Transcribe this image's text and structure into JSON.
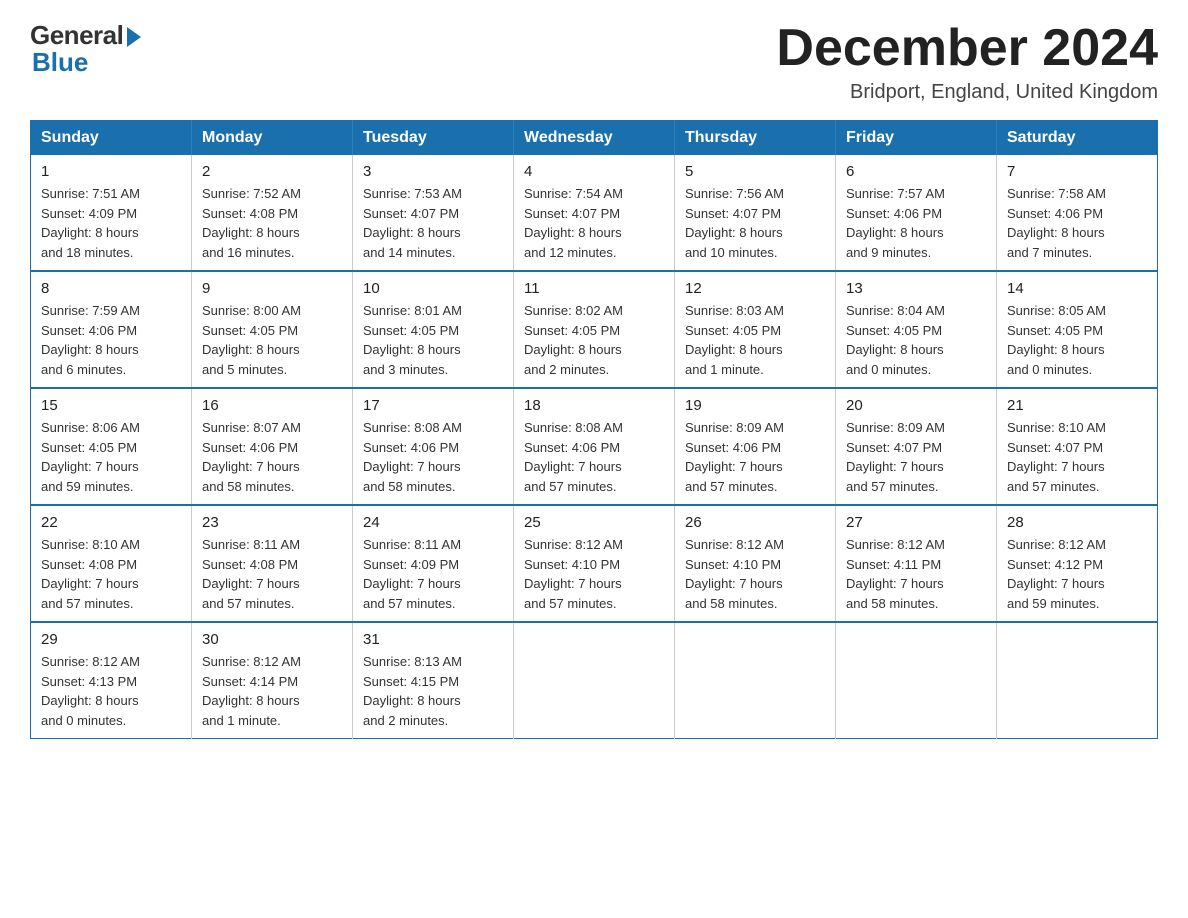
{
  "logo": {
    "general": "General",
    "blue": "Blue"
  },
  "title": {
    "month": "December 2024",
    "location": "Bridport, England, United Kingdom"
  },
  "weekdays": [
    "Sunday",
    "Monday",
    "Tuesday",
    "Wednesday",
    "Thursday",
    "Friday",
    "Saturday"
  ],
  "weeks": [
    [
      {
        "day": "1",
        "sunrise": "7:51 AM",
        "sunset": "4:09 PM",
        "daylight": "8 hours and 18 minutes."
      },
      {
        "day": "2",
        "sunrise": "7:52 AM",
        "sunset": "4:08 PM",
        "daylight": "8 hours and 16 minutes."
      },
      {
        "day": "3",
        "sunrise": "7:53 AM",
        "sunset": "4:07 PM",
        "daylight": "8 hours and 14 minutes."
      },
      {
        "day": "4",
        "sunrise": "7:54 AM",
        "sunset": "4:07 PM",
        "daylight": "8 hours and 12 minutes."
      },
      {
        "day": "5",
        "sunrise": "7:56 AM",
        "sunset": "4:07 PM",
        "daylight": "8 hours and 10 minutes."
      },
      {
        "day": "6",
        "sunrise": "7:57 AM",
        "sunset": "4:06 PM",
        "daylight": "8 hours and 9 minutes."
      },
      {
        "day": "7",
        "sunrise": "7:58 AM",
        "sunset": "4:06 PM",
        "daylight": "8 hours and 7 minutes."
      }
    ],
    [
      {
        "day": "8",
        "sunrise": "7:59 AM",
        "sunset": "4:06 PM",
        "daylight": "8 hours and 6 minutes."
      },
      {
        "day": "9",
        "sunrise": "8:00 AM",
        "sunset": "4:05 PM",
        "daylight": "8 hours and 5 minutes."
      },
      {
        "day": "10",
        "sunrise": "8:01 AM",
        "sunset": "4:05 PM",
        "daylight": "8 hours and 3 minutes."
      },
      {
        "day": "11",
        "sunrise": "8:02 AM",
        "sunset": "4:05 PM",
        "daylight": "8 hours and 2 minutes."
      },
      {
        "day": "12",
        "sunrise": "8:03 AM",
        "sunset": "4:05 PM",
        "daylight": "8 hours and 1 minute."
      },
      {
        "day": "13",
        "sunrise": "8:04 AM",
        "sunset": "4:05 PM",
        "daylight": "8 hours and 0 minutes."
      },
      {
        "day": "14",
        "sunrise": "8:05 AM",
        "sunset": "4:05 PM",
        "daylight": "8 hours and 0 minutes."
      }
    ],
    [
      {
        "day": "15",
        "sunrise": "8:06 AM",
        "sunset": "4:05 PM",
        "daylight": "7 hours and 59 minutes."
      },
      {
        "day": "16",
        "sunrise": "8:07 AM",
        "sunset": "4:06 PM",
        "daylight": "7 hours and 58 minutes."
      },
      {
        "day": "17",
        "sunrise": "8:08 AM",
        "sunset": "4:06 PM",
        "daylight": "7 hours and 58 minutes."
      },
      {
        "day": "18",
        "sunrise": "8:08 AM",
        "sunset": "4:06 PM",
        "daylight": "7 hours and 57 minutes."
      },
      {
        "day": "19",
        "sunrise": "8:09 AM",
        "sunset": "4:06 PM",
        "daylight": "7 hours and 57 minutes."
      },
      {
        "day": "20",
        "sunrise": "8:09 AM",
        "sunset": "4:07 PM",
        "daylight": "7 hours and 57 minutes."
      },
      {
        "day": "21",
        "sunrise": "8:10 AM",
        "sunset": "4:07 PM",
        "daylight": "7 hours and 57 minutes."
      }
    ],
    [
      {
        "day": "22",
        "sunrise": "8:10 AM",
        "sunset": "4:08 PM",
        "daylight": "7 hours and 57 minutes."
      },
      {
        "day": "23",
        "sunrise": "8:11 AM",
        "sunset": "4:08 PM",
        "daylight": "7 hours and 57 minutes."
      },
      {
        "day": "24",
        "sunrise": "8:11 AM",
        "sunset": "4:09 PM",
        "daylight": "7 hours and 57 minutes."
      },
      {
        "day": "25",
        "sunrise": "8:12 AM",
        "sunset": "4:10 PM",
        "daylight": "7 hours and 57 minutes."
      },
      {
        "day": "26",
        "sunrise": "8:12 AM",
        "sunset": "4:10 PM",
        "daylight": "7 hours and 58 minutes."
      },
      {
        "day": "27",
        "sunrise": "8:12 AM",
        "sunset": "4:11 PM",
        "daylight": "7 hours and 58 minutes."
      },
      {
        "day": "28",
        "sunrise": "8:12 AM",
        "sunset": "4:12 PM",
        "daylight": "7 hours and 59 minutes."
      }
    ],
    [
      {
        "day": "29",
        "sunrise": "8:12 AM",
        "sunset": "4:13 PM",
        "daylight": "8 hours and 0 minutes."
      },
      {
        "day": "30",
        "sunrise": "8:12 AM",
        "sunset": "4:14 PM",
        "daylight": "8 hours and 1 minute."
      },
      {
        "day": "31",
        "sunrise": "8:13 AM",
        "sunset": "4:15 PM",
        "daylight": "8 hours and 2 minutes."
      },
      null,
      null,
      null,
      null
    ]
  ],
  "labels": {
    "sunrise": "Sunrise:",
    "sunset": "Sunset:",
    "daylight": "Daylight:"
  }
}
